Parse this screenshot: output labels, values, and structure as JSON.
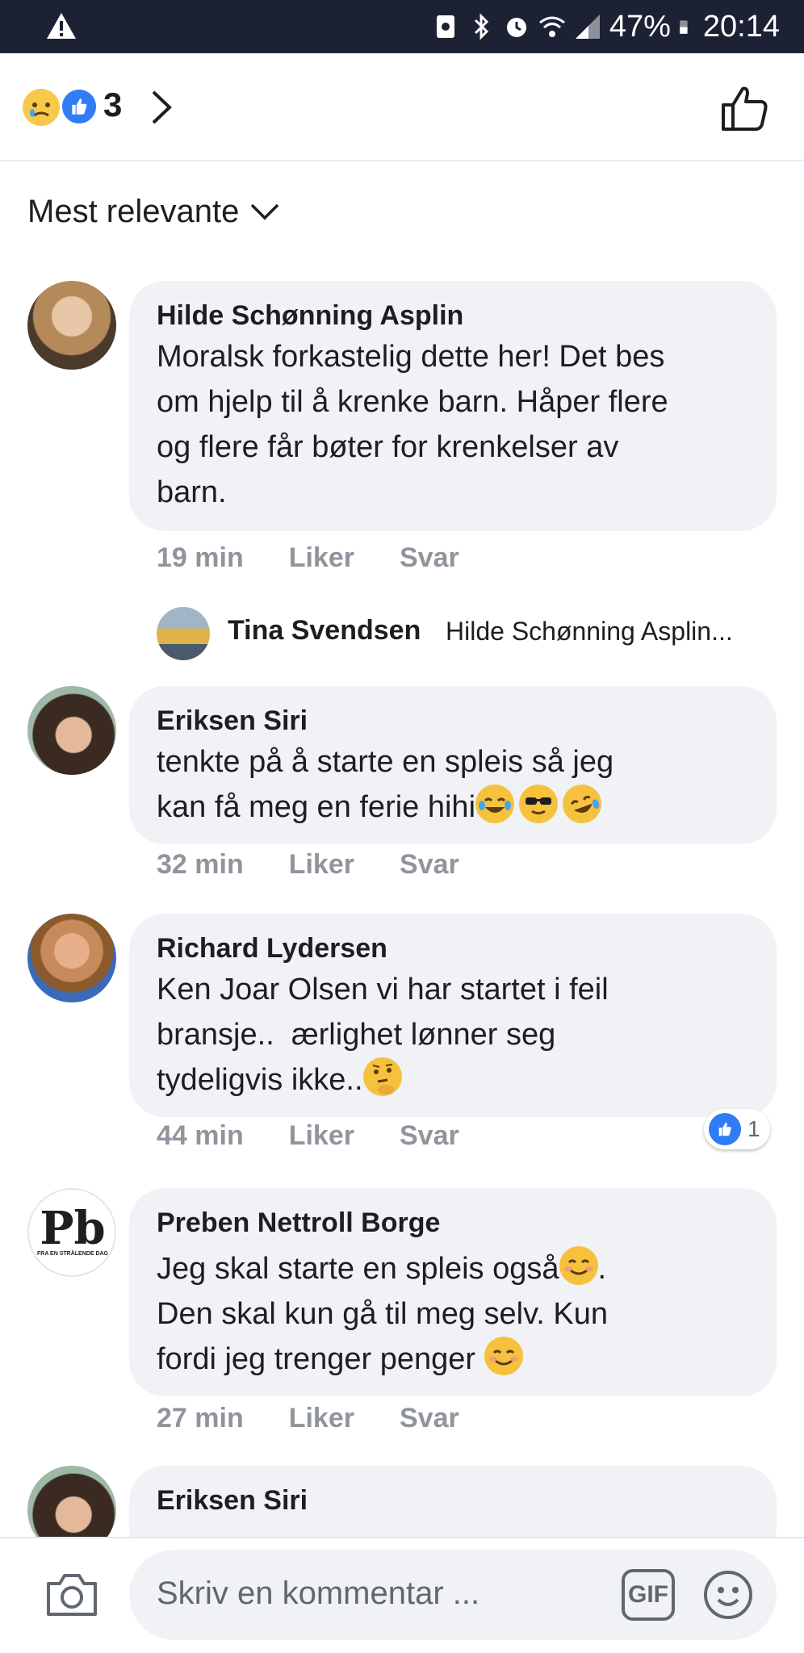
{
  "status_bar": {
    "battery": "47%",
    "time": "20:14"
  },
  "reactions": {
    "count": "3"
  },
  "sort": {
    "label": "Mest relevante"
  },
  "comments": [
    {
      "name": "Hilde Schønning Asplin",
      "lines": [
        "Moralsk forkastelig dette her! Det bes",
        "om hjelp til å krenke barn. Håper flere",
        "og flere får bøter for krenkelser av",
        "barn."
      ],
      "time": "19 min",
      "like": "Liker",
      "reply": "Svar"
    },
    {
      "name": "Eriksen Siri",
      "lines": [
        "tenkte på å starte en spleis så jeg",
        "kan få meg en ferie hihi"
      ],
      "time": "32 min",
      "like": "Liker",
      "reply": "Svar"
    },
    {
      "name": "Richard Lydersen",
      "lines": [
        "Ken Joar Olsen vi har startet i feil",
        "bransje..  ærlighet lønner seg",
        "tydeligvis ikke.."
      ],
      "time": "44 min",
      "like": "Liker",
      "reply": "Svar",
      "likes": "1"
    },
    {
      "name": "Preben Nettroll Borge",
      "lines": [
        "Jeg skal starte en spleis også",
        "Den skal kun gå til meg selv. Kun",
        "fordi jeg trenger penger "
      ],
      "time": "27 min",
      "like": "Liker",
      "reply": "Svar",
      "avatar_text": "Pb",
      "avatar_subtext": "FRA EN STRÅLENDE DAG"
    },
    {
      "name": "Eriksen Siri"
    }
  ],
  "reply_preview": {
    "name": "Tina Svendsen",
    "text": "Hilde Schønning Asplin..."
  },
  "composer": {
    "placeholder": "Skriv en kommentar ...",
    "gif_label": "GIF"
  }
}
